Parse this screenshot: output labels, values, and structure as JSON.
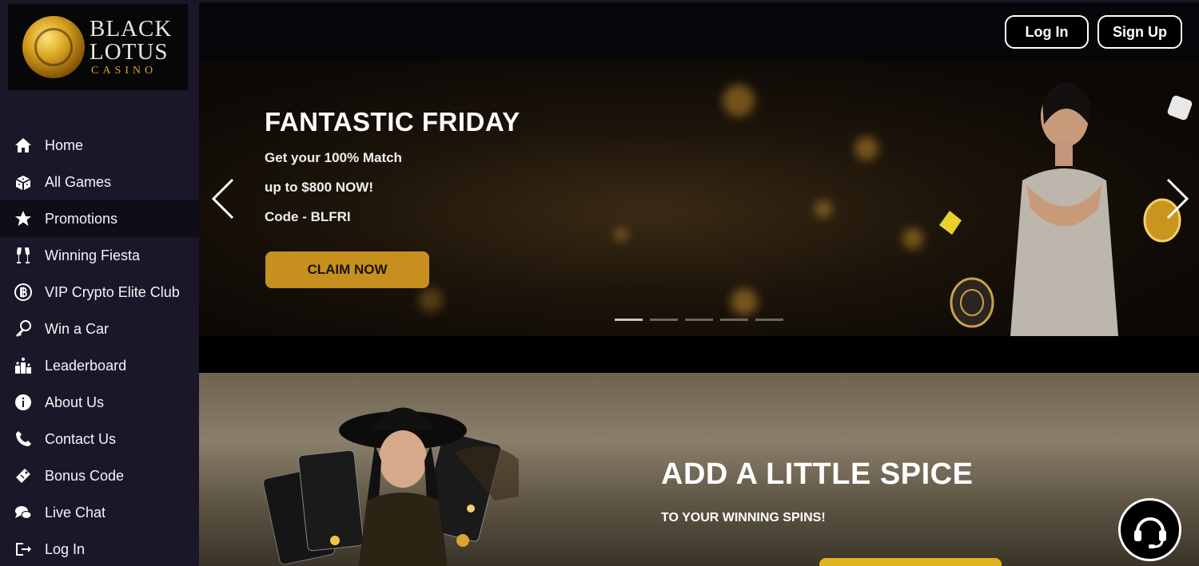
{
  "logo": {
    "line1": "BLACK",
    "line2": "LOTUS",
    "line3": "CASINO"
  },
  "header": {
    "login_label": "Log In",
    "signup_label": "Sign Up"
  },
  "sidebar": {
    "items": [
      {
        "label": "Home",
        "icon": "home-icon"
      },
      {
        "label": "All Games",
        "icon": "dice-icon"
      },
      {
        "label": "Promotions",
        "icon": "star-icon"
      },
      {
        "label": "Winning Fiesta",
        "icon": "champagne-icon"
      },
      {
        "label": "VIP Crypto Elite Club",
        "icon": "bitcoin-icon"
      },
      {
        "label": "Win a Car",
        "icon": "car-key-icon"
      },
      {
        "label": "Leaderboard",
        "icon": "podium-icon"
      },
      {
        "label": "About Us",
        "icon": "info-icon"
      },
      {
        "label": "Contact Us",
        "icon": "phone-icon"
      },
      {
        "label": "Bonus Code",
        "icon": "ticket-icon"
      },
      {
        "label": "Live Chat",
        "icon": "chat-bubbles-icon"
      },
      {
        "label": "Log In",
        "icon": "login-icon"
      }
    ],
    "active_item": "Promotions"
  },
  "hero": {
    "title": "FANTASTIC FRIDAY",
    "line1": "Get your 100% Match",
    "line2": "up to $800 NOW!",
    "line3": "Code - BLFRI",
    "button_label": "CLAIM NOW",
    "slide_count": 5,
    "active_slide": 1
  },
  "banner2": {
    "title": "ADD A LITTLE SPICE",
    "subtitle": "TO YOUR WINNING SPINS!"
  },
  "colors": {
    "sidebar_bg": "#1b1729",
    "accent_gold": "#c7901e",
    "button_yellow": "#e0b21d"
  }
}
